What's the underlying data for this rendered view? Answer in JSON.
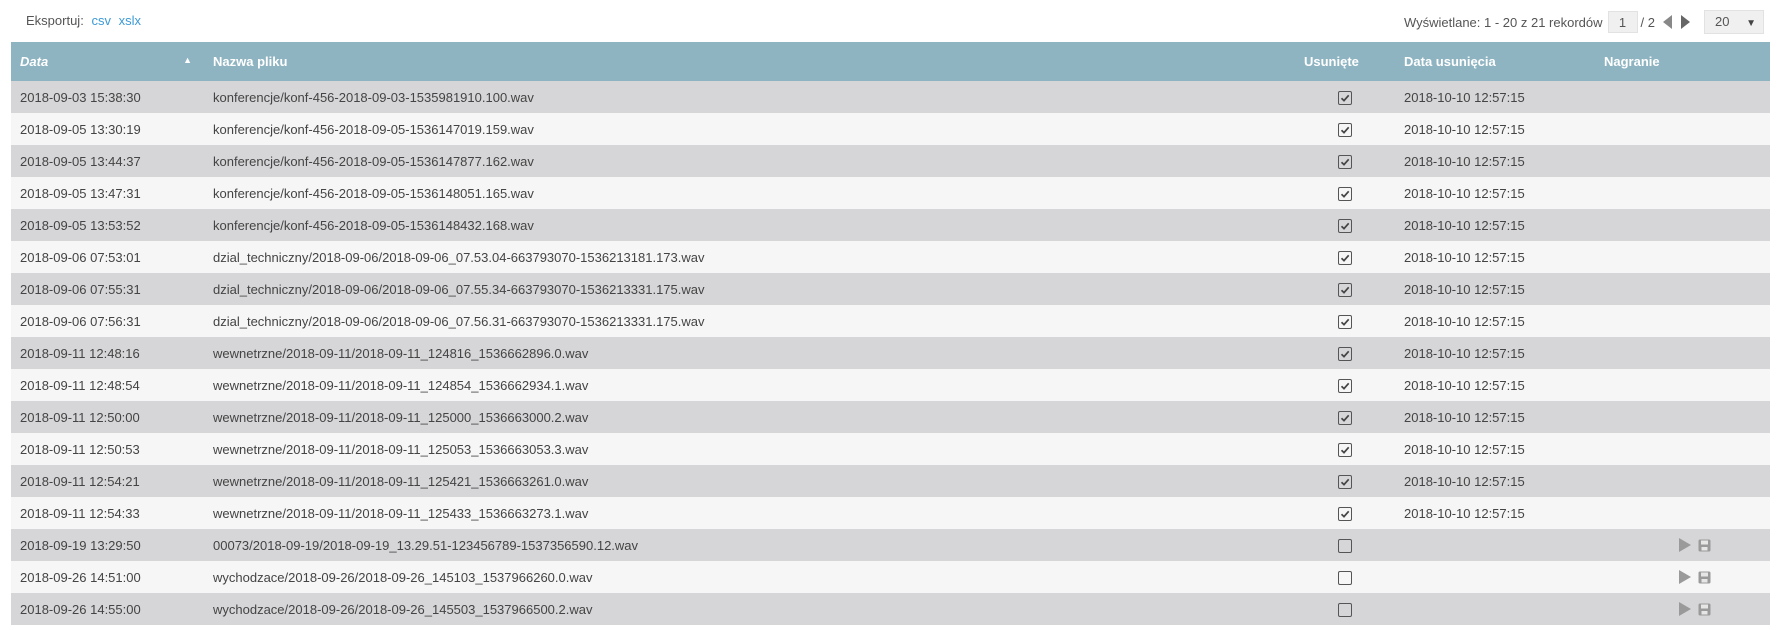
{
  "export": {
    "label": "Eksportuj:",
    "csv": "csv",
    "xslx": "xslx"
  },
  "pager": {
    "range_text": "Wyświetlane: 1 - 20 z 21 rekordów",
    "current_page": "1",
    "total_pages": "/ 2",
    "page_size": "20"
  },
  "table": {
    "headers": {
      "date": "Data",
      "filename": "Nazwa pliku",
      "deleted": "Usunięte",
      "deleted_date": "Data usunięcia",
      "recording": "Nagranie"
    },
    "rows": [
      {
        "date": "2018-09-03 15:38:30",
        "file": "konferencje/konf-456-2018-09-03-1535981910.100.wav",
        "deleted": true,
        "deleted_date": "2018-10-10 12:57:15",
        "has_recording": false
      },
      {
        "date": "2018-09-05 13:30:19",
        "file": "konferencje/konf-456-2018-09-05-1536147019.159.wav",
        "deleted": true,
        "deleted_date": "2018-10-10 12:57:15",
        "has_recording": false
      },
      {
        "date": "2018-09-05 13:44:37",
        "file": "konferencje/konf-456-2018-09-05-1536147877.162.wav",
        "deleted": true,
        "deleted_date": "2018-10-10 12:57:15",
        "has_recording": false
      },
      {
        "date": "2018-09-05 13:47:31",
        "file": "konferencje/konf-456-2018-09-05-1536148051.165.wav",
        "deleted": true,
        "deleted_date": "2018-10-10 12:57:15",
        "has_recording": false
      },
      {
        "date": "2018-09-05 13:53:52",
        "file": "konferencje/konf-456-2018-09-05-1536148432.168.wav",
        "deleted": true,
        "deleted_date": "2018-10-10 12:57:15",
        "has_recording": false
      },
      {
        "date": "2018-09-06 07:53:01",
        "file": "dzial_techniczny/2018-09-06/2018-09-06_07.53.04-663793070-1536213181.173.wav",
        "deleted": true,
        "deleted_date": "2018-10-10 12:57:15",
        "has_recording": false
      },
      {
        "date": "2018-09-06 07:55:31",
        "file": "dzial_techniczny/2018-09-06/2018-09-06_07.55.34-663793070-1536213331.175.wav",
        "deleted": true,
        "deleted_date": "2018-10-10 12:57:15",
        "has_recording": false
      },
      {
        "date": "2018-09-06 07:56:31",
        "file": "dzial_techniczny/2018-09-06/2018-09-06_07.56.31-663793070-1536213331.175.wav",
        "deleted": true,
        "deleted_date": "2018-10-10 12:57:15",
        "has_recording": false
      },
      {
        "date": "2018-09-11 12:48:16",
        "file": "wewnetrzne/2018-09-11/2018-09-11_124816_1536662896.0.wav",
        "deleted": true,
        "deleted_date": "2018-10-10 12:57:15",
        "has_recording": false
      },
      {
        "date": "2018-09-11 12:48:54",
        "file": "wewnetrzne/2018-09-11/2018-09-11_124854_1536662934.1.wav",
        "deleted": true,
        "deleted_date": "2018-10-10 12:57:15",
        "has_recording": false
      },
      {
        "date": "2018-09-11 12:50:00",
        "file": "wewnetrzne/2018-09-11/2018-09-11_125000_1536663000.2.wav",
        "deleted": true,
        "deleted_date": "2018-10-10 12:57:15",
        "has_recording": false
      },
      {
        "date": "2018-09-11 12:50:53",
        "file": "wewnetrzne/2018-09-11/2018-09-11_125053_1536663053.3.wav",
        "deleted": true,
        "deleted_date": "2018-10-10 12:57:15",
        "has_recording": false
      },
      {
        "date": "2018-09-11 12:54:21",
        "file": "wewnetrzne/2018-09-11/2018-09-11_125421_1536663261.0.wav",
        "deleted": true,
        "deleted_date": "2018-10-10 12:57:15",
        "has_recording": false
      },
      {
        "date": "2018-09-11 12:54:33",
        "file": "wewnetrzne/2018-09-11/2018-09-11_125433_1536663273.1.wav",
        "deleted": true,
        "deleted_date": "2018-10-10 12:57:15",
        "has_recording": false
      },
      {
        "date": "2018-09-19 13:29:50",
        "file": "00073/2018-09-19/2018-09-19_13.29.51-123456789-1537356590.12.wav",
        "deleted": false,
        "deleted_date": "",
        "has_recording": true
      },
      {
        "date": "2018-09-26 14:51:00",
        "file": "wychodzace/2018-09-26/2018-09-26_145103_1537966260.0.wav",
        "deleted": false,
        "deleted_date": "",
        "has_recording": true
      },
      {
        "date": "2018-09-26 14:55:00",
        "file": "wychodzace/2018-09-26/2018-09-26_145503_1537966500.2.wav",
        "deleted": false,
        "deleted_date": "",
        "has_recording": true
      }
    ]
  },
  "icons": {
    "sort": "sort-asc-icon",
    "checked": "checkbox-checked-icon",
    "unchecked": "checkbox-unchecked-icon",
    "play": "play-icon",
    "save": "save-icon",
    "prev": "prev-page-icon",
    "next": "next-page-icon",
    "dropdown": "chevron-down-icon"
  },
  "colors": {
    "header_bg": "#8eb4c2",
    "row_odd": "#d6d6d8",
    "row_even": "#f6f6f6",
    "link": "#3c9ad6"
  }
}
